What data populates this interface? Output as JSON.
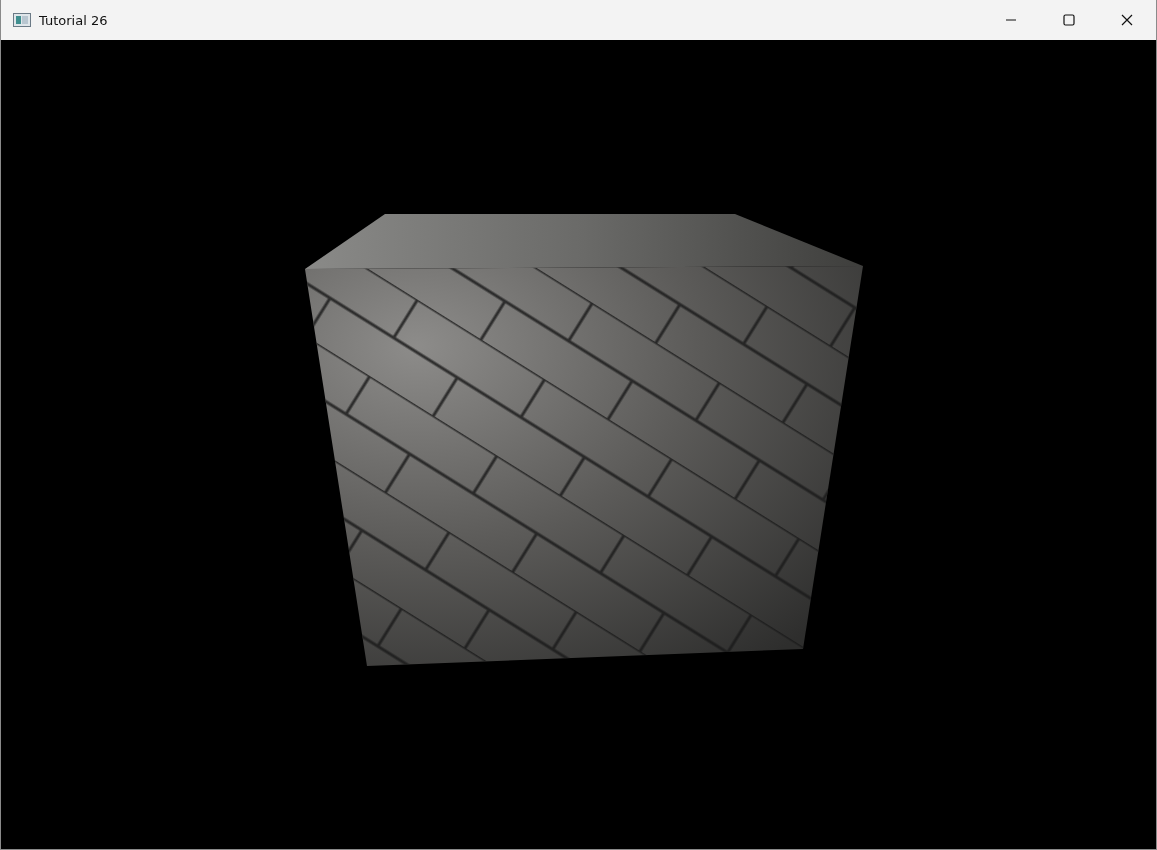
{
  "window": {
    "title": "Tutorial 26"
  }
}
